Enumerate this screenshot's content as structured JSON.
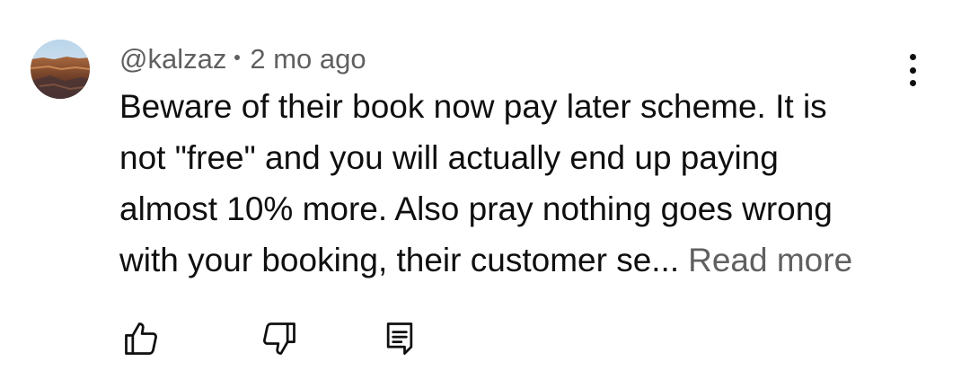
{
  "comment": {
    "author": "@kalzaz",
    "separator": "•",
    "timestamp": "2 mo ago",
    "text_lines": [
      "Beware of their book now pay later scheme. It is",
      "not \"free\" and you will actually end up paying",
      "almost 10% more. Also pray nothing goes wrong",
      "with your booking, their customer se..."
    ],
    "read_more_label": "Read more"
  },
  "actions": {
    "like_icon": "thumbs-up-outline",
    "dislike_icon": "thumbs-down-outline",
    "reply_icon": "comment-reply-outline"
  },
  "menu_icon": "vertical-ellipsis",
  "colors": {
    "text_primary": "#0f0f0f",
    "text_secondary": "#606060",
    "background": "#ffffff"
  }
}
